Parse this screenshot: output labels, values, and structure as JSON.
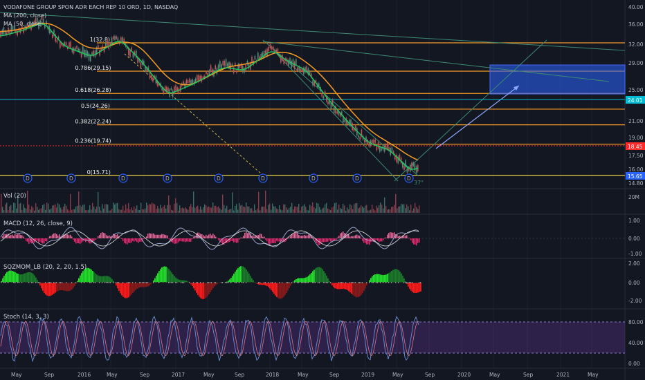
{
  "header": {
    "symbol": "VODAFONE GROUP SPON ADR EACH REP 10 ORD, 1D, NASDAQ",
    "ma200": "MA (200, close)",
    "ma50": "MA (50, close)"
  },
  "panes": {
    "vol": "Vol (20)",
    "macd": "MACD (12, 26, close, 9)",
    "sqz": "SQZMOM_LB (20, 2, 20, 1.5)",
    "stoch": "Stoch (14, 3, 3)"
  },
  "price_axis": [
    "40.00",
    "36.00",
    "32.00",
    "29.00",
    "25.00",
    "21.00",
    "19.00",
    "17.50",
    "16.00",
    "14.80"
  ],
  "price_badges": {
    "cyan": "24.01",
    "red": "18.45",
    "blue": "15.65"
  },
  "vol_axis": [
    "20M"
  ],
  "macd_axis": [
    "1.00",
    "0.00",
    "-1.00"
  ],
  "sqz_axis": [
    "2.00",
    "0.00",
    "-2.00"
  ],
  "stoch_axis": [
    "80.00",
    "40.00",
    "0.00"
  ],
  "time_axis": [
    "May",
    "Sep",
    "2016",
    "May",
    "Sep",
    "2017",
    "May",
    "Sep",
    "2018",
    "May",
    "Sep",
    "2019",
    "May",
    "Sep",
    "2020",
    "May",
    "Sep",
    "2021",
    "May"
  ],
  "fib_levels": [
    {
      "label": "1(32.8)",
      "value": 32.8
    },
    {
      "label": "0.786(29.15)",
      "value": 29.15
    },
    {
      "label": "0.618(26.28)",
      "value": 26.28
    },
    {
      "label": "0.5(24.26)",
      "value": 24.26
    },
    {
      "label": "0.382(22.24)",
      "value": 22.24
    },
    {
      "label": "0.236(19.74)",
      "value": 19.74
    },
    {
      "label": "0(15.71)",
      "value": 15.71
    }
  ],
  "dividend_marker": "D",
  "angle_label": "37°",
  "colors": {
    "bg": "#131722",
    "fib": "#f59b25",
    "ma50": "#22c55e",
    "ma200": "#f59b25",
    "red": "#ff2a2a",
    "cyan": "#00bcd4",
    "blue": "#2962ff"
  }
}
